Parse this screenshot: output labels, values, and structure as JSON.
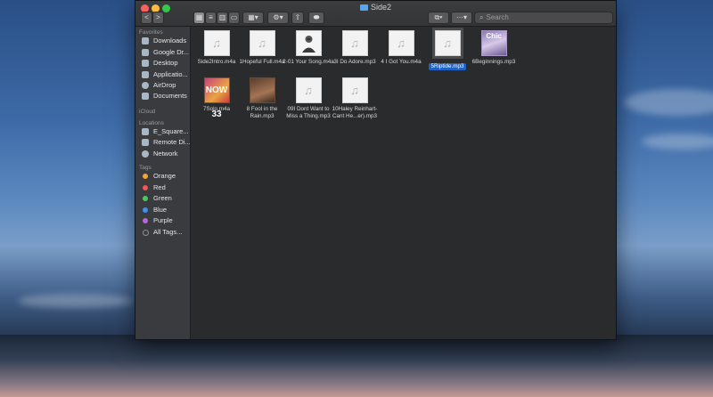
{
  "window": {
    "title": "Side2"
  },
  "toolbar": {
    "back": "<",
    "forward": ">",
    "search_placeholder": "Search"
  },
  "sidebar": {
    "favorites_header": "Favorites",
    "favorites": [
      {
        "label": "Downloads"
      },
      {
        "label": "Google Dr..."
      },
      {
        "label": "Desktop"
      },
      {
        "label": "Applicatio..."
      },
      {
        "label": "AirDrop"
      },
      {
        "label": "Documents"
      }
    ],
    "icloud_header": "iCloud",
    "locations_header": "Locations",
    "locations": [
      {
        "label": "E_Square..."
      },
      {
        "label": "Remote Di..."
      },
      {
        "label": "Network"
      }
    ],
    "tags_header": "Tags",
    "tags": [
      {
        "label": "Orange",
        "color": "#f5a33b"
      },
      {
        "label": "Red",
        "color": "#f2574e"
      },
      {
        "label": "Green",
        "color": "#4fc561"
      },
      {
        "label": "Blue",
        "color": "#3d8ff0"
      },
      {
        "label": "Purple",
        "color": "#b567d2"
      },
      {
        "label": "All Tags...",
        "color": "#8e8e90"
      }
    ]
  },
  "files": [
    {
      "name": "Side2Intro.m4a"
    },
    {
      "name": "1Hopeful Full.m4a"
    },
    {
      "name": "2-01 Your Song.m4a"
    },
    {
      "name": "3I Do Adore.mp3"
    },
    {
      "name": "4 I Got You.m4a"
    },
    {
      "name": "5Riptide.mp3",
      "selected": true
    },
    {
      "name": "6Beginnings.mp3"
    },
    {
      "name": "7Solo.m4a"
    },
    {
      "name": "8 Fool in the Rain.mp3"
    },
    {
      "name": "09I Dont Want to Miss a Thing.mp3"
    },
    {
      "name": "10Haley Reinhart- Cant He...er).mp3"
    }
  ],
  "art": {
    "now_text": "NOW 33",
    "slide_text": "Chic"
  }
}
